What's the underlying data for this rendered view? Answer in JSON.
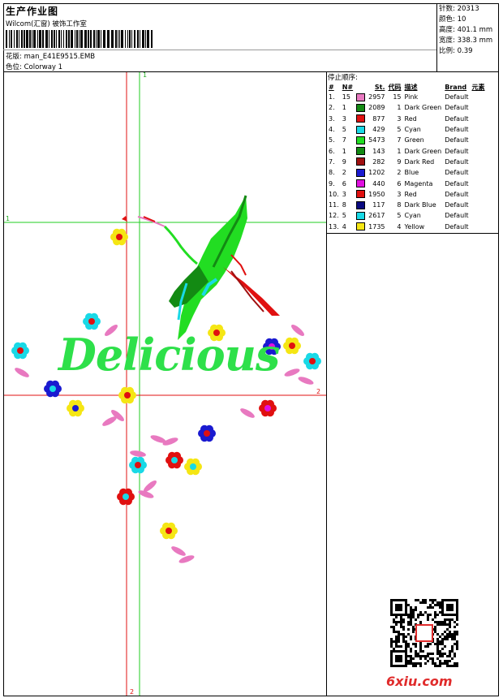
{
  "header": {
    "title": "生产作业图",
    "company": "Wilcom(汇窗) 被饰工作室",
    "design_label": "花版:",
    "design_file": "man_E41E9515.EMB",
    "colorway_label": "色位:",
    "colorway": "Colorway 1"
  },
  "stats": {
    "stitches_label": "针数:",
    "stitches": "20313",
    "colors_label": "颜色:",
    "colors": "10",
    "height_label": "高度:",
    "height": "401.1 mm",
    "width_label": "宽度:",
    "width": "338.3 mm",
    "scale_label": "比例:",
    "scale": "0.39"
  },
  "sequence": {
    "title": "停止顺序:",
    "headers": [
      "#",
      "N#",
      "St.",
      "代码",
      "描述",
      "Brand",
      "元素"
    ],
    "rows": [
      {
        "idx": "1.",
        "n": "15",
        "color": "#e879c0",
        "st": "2957",
        "code": "15",
        "desc": "Pink",
        "brand": "Default"
      },
      {
        "idx": "2.",
        "n": "1",
        "color": "#138a13",
        "st": "2089",
        "code": "1",
        "desc": "Dark Green",
        "brand": "Default"
      },
      {
        "idx": "3.",
        "n": "3",
        "color": "#e01010",
        "st": "877",
        "code": "3",
        "desc": "Red",
        "brand": "Default"
      },
      {
        "idx": "4.",
        "n": "5",
        "color": "#19d9e6",
        "st": "429",
        "code": "5",
        "desc": "Cyan",
        "brand": "Default"
      },
      {
        "idx": "5.",
        "n": "7",
        "color": "#22dd22",
        "st": "5473",
        "code": "7",
        "desc": "Green",
        "brand": "Default"
      },
      {
        "idx": "6.",
        "n": "1",
        "color": "#138a13",
        "st": "143",
        "code": "1",
        "desc": "Dark Green",
        "brand": "Default"
      },
      {
        "idx": "7.",
        "n": "9",
        "color": "#a01010",
        "st": "282",
        "code": "9",
        "desc": "Dark Red",
        "brand": "Default"
      },
      {
        "idx": "8.",
        "n": "2",
        "color": "#1a1ad0",
        "st": "1202",
        "code": "2",
        "desc": "Blue",
        "brand": "Default"
      },
      {
        "idx": "9.",
        "n": "6",
        "color": "#e010e0",
        "st": "440",
        "code": "6",
        "desc": "Magenta",
        "brand": "Default"
      },
      {
        "idx": "10.",
        "n": "3",
        "color": "#e01010",
        "st": "1950",
        "code": "3",
        "desc": "Red",
        "brand": "Default"
      },
      {
        "idx": "11.",
        "n": "8",
        "color": "#0a0a80",
        "st": "117",
        "code": "8",
        "desc": "Dark Blue",
        "brand": "Default"
      },
      {
        "idx": "12.",
        "n": "5",
        "color": "#19d9e6",
        "st": "2617",
        "code": "5",
        "desc": "Cyan",
        "brand": "Default"
      },
      {
        "idx": "13.",
        "n": "4",
        "color": "#f5e614",
        "st": "1735",
        "code": "4",
        "desc": "Yellow",
        "brand": "Default"
      }
    ]
  },
  "design": {
    "text": "Delicious",
    "axis_labels": {
      "v_green_top": "1",
      "h_green_left": "1",
      "h_red_right": "2",
      "v_red_bottom": "2"
    }
  },
  "watermark": {
    "site": "6xiu.com"
  }
}
